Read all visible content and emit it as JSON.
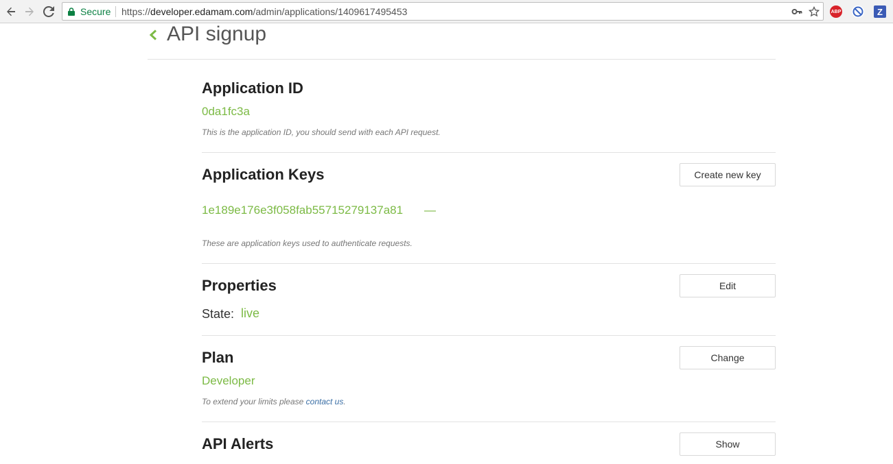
{
  "browser": {
    "secure_label": "Secure",
    "url_scheme": "https://",
    "url_host": "developer.edamam.com",
    "url_path": "/admin/applications/1409617495453",
    "extensions": [
      {
        "name": "adblock-plus-icon",
        "label": "ABP",
        "color": "#d8232a"
      },
      {
        "name": "block-icon",
        "label": "",
        "color": "#3b66c4"
      },
      {
        "name": "z-extension-icon",
        "label": "Z",
        "color": "#3b5bb5"
      }
    ]
  },
  "page": {
    "title": "API signup"
  },
  "app_id": {
    "heading": "Application ID",
    "value": "0da1fc3a",
    "note": "This is the application ID, you should send with each API request."
  },
  "app_keys": {
    "heading": "Application Keys",
    "button": "Create new key",
    "key": "1e189e176e3f058fab55715279137a81",
    "dash": "—",
    "note": "These are application keys used to authenticate requests."
  },
  "properties": {
    "heading": "Properties",
    "button": "Edit",
    "state_label": "State:",
    "state_value": "live"
  },
  "plan": {
    "heading": "Plan",
    "button": "Change",
    "value": "Developer",
    "note_prefix": "To extend your limits please ",
    "note_link": "contact us",
    "note_suffix": "."
  },
  "alerts": {
    "heading": "API Alerts",
    "button": "Show"
  },
  "colors": {
    "accent_green": "#7cba45",
    "secure_green": "#0b8043",
    "link_blue": "#3a6ea5"
  }
}
